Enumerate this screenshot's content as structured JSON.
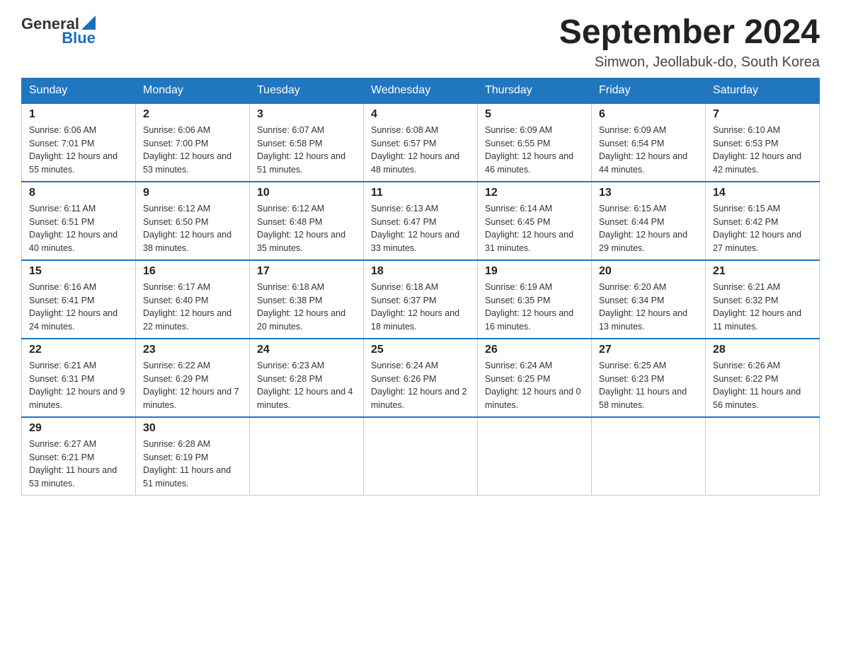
{
  "header": {
    "logo": {
      "general": "General",
      "blue": "Blue"
    },
    "title": "September 2024",
    "location": "Simwon, Jeollabuk-do, South Korea"
  },
  "days_of_week": [
    "Sunday",
    "Monday",
    "Tuesday",
    "Wednesday",
    "Thursday",
    "Friday",
    "Saturday"
  ],
  "weeks": [
    [
      {
        "day": "1",
        "sunrise": "Sunrise: 6:06 AM",
        "sunset": "Sunset: 7:01 PM",
        "daylight": "Daylight: 12 hours and 55 minutes."
      },
      {
        "day": "2",
        "sunrise": "Sunrise: 6:06 AM",
        "sunset": "Sunset: 7:00 PM",
        "daylight": "Daylight: 12 hours and 53 minutes."
      },
      {
        "day": "3",
        "sunrise": "Sunrise: 6:07 AM",
        "sunset": "Sunset: 6:58 PM",
        "daylight": "Daylight: 12 hours and 51 minutes."
      },
      {
        "day": "4",
        "sunrise": "Sunrise: 6:08 AM",
        "sunset": "Sunset: 6:57 PM",
        "daylight": "Daylight: 12 hours and 48 minutes."
      },
      {
        "day": "5",
        "sunrise": "Sunrise: 6:09 AM",
        "sunset": "Sunset: 6:55 PM",
        "daylight": "Daylight: 12 hours and 46 minutes."
      },
      {
        "day": "6",
        "sunrise": "Sunrise: 6:09 AM",
        "sunset": "Sunset: 6:54 PM",
        "daylight": "Daylight: 12 hours and 44 minutes."
      },
      {
        "day": "7",
        "sunrise": "Sunrise: 6:10 AM",
        "sunset": "Sunset: 6:53 PM",
        "daylight": "Daylight: 12 hours and 42 minutes."
      }
    ],
    [
      {
        "day": "8",
        "sunrise": "Sunrise: 6:11 AM",
        "sunset": "Sunset: 6:51 PM",
        "daylight": "Daylight: 12 hours and 40 minutes."
      },
      {
        "day": "9",
        "sunrise": "Sunrise: 6:12 AM",
        "sunset": "Sunset: 6:50 PM",
        "daylight": "Daylight: 12 hours and 38 minutes."
      },
      {
        "day": "10",
        "sunrise": "Sunrise: 6:12 AM",
        "sunset": "Sunset: 6:48 PM",
        "daylight": "Daylight: 12 hours and 35 minutes."
      },
      {
        "day": "11",
        "sunrise": "Sunrise: 6:13 AM",
        "sunset": "Sunset: 6:47 PM",
        "daylight": "Daylight: 12 hours and 33 minutes."
      },
      {
        "day": "12",
        "sunrise": "Sunrise: 6:14 AM",
        "sunset": "Sunset: 6:45 PM",
        "daylight": "Daylight: 12 hours and 31 minutes."
      },
      {
        "day": "13",
        "sunrise": "Sunrise: 6:15 AM",
        "sunset": "Sunset: 6:44 PM",
        "daylight": "Daylight: 12 hours and 29 minutes."
      },
      {
        "day": "14",
        "sunrise": "Sunrise: 6:15 AM",
        "sunset": "Sunset: 6:42 PM",
        "daylight": "Daylight: 12 hours and 27 minutes."
      }
    ],
    [
      {
        "day": "15",
        "sunrise": "Sunrise: 6:16 AM",
        "sunset": "Sunset: 6:41 PM",
        "daylight": "Daylight: 12 hours and 24 minutes."
      },
      {
        "day": "16",
        "sunrise": "Sunrise: 6:17 AM",
        "sunset": "Sunset: 6:40 PM",
        "daylight": "Daylight: 12 hours and 22 minutes."
      },
      {
        "day": "17",
        "sunrise": "Sunrise: 6:18 AM",
        "sunset": "Sunset: 6:38 PM",
        "daylight": "Daylight: 12 hours and 20 minutes."
      },
      {
        "day": "18",
        "sunrise": "Sunrise: 6:18 AM",
        "sunset": "Sunset: 6:37 PM",
        "daylight": "Daylight: 12 hours and 18 minutes."
      },
      {
        "day": "19",
        "sunrise": "Sunrise: 6:19 AM",
        "sunset": "Sunset: 6:35 PM",
        "daylight": "Daylight: 12 hours and 16 minutes."
      },
      {
        "day": "20",
        "sunrise": "Sunrise: 6:20 AM",
        "sunset": "Sunset: 6:34 PM",
        "daylight": "Daylight: 12 hours and 13 minutes."
      },
      {
        "day": "21",
        "sunrise": "Sunrise: 6:21 AM",
        "sunset": "Sunset: 6:32 PM",
        "daylight": "Daylight: 12 hours and 11 minutes."
      }
    ],
    [
      {
        "day": "22",
        "sunrise": "Sunrise: 6:21 AM",
        "sunset": "Sunset: 6:31 PM",
        "daylight": "Daylight: 12 hours and 9 minutes."
      },
      {
        "day": "23",
        "sunrise": "Sunrise: 6:22 AM",
        "sunset": "Sunset: 6:29 PM",
        "daylight": "Daylight: 12 hours and 7 minutes."
      },
      {
        "day": "24",
        "sunrise": "Sunrise: 6:23 AM",
        "sunset": "Sunset: 6:28 PM",
        "daylight": "Daylight: 12 hours and 4 minutes."
      },
      {
        "day": "25",
        "sunrise": "Sunrise: 6:24 AM",
        "sunset": "Sunset: 6:26 PM",
        "daylight": "Daylight: 12 hours and 2 minutes."
      },
      {
        "day": "26",
        "sunrise": "Sunrise: 6:24 AM",
        "sunset": "Sunset: 6:25 PM",
        "daylight": "Daylight: 12 hours and 0 minutes."
      },
      {
        "day": "27",
        "sunrise": "Sunrise: 6:25 AM",
        "sunset": "Sunset: 6:23 PM",
        "daylight": "Daylight: 11 hours and 58 minutes."
      },
      {
        "day": "28",
        "sunrise": "Sunrise: 6:26 AM",
        "sunset": "Sunset: 6:22 PM",
        "daylight": "Daylight: 11 hours and 56 minutes."
      }
    ],
    [
      {
        "day": "29",
        "sunrise": "Sunrise: 6:27 AM",
        "sunset": "Sunset: 6:21 PM",
        "daylight": "Daylight: 11 hours and 53 minutes."
      },
      {
        "day": "30",
        "sunrise": "Sunrise: 6:28 AM",
        "sunset": "Sunset: 6:19 PM",
        "daylight": "Daylight: 11 hours and 51 minutes."
      },
      null,
      null,
      null,
      null,
      null
    ]
  ]
}
